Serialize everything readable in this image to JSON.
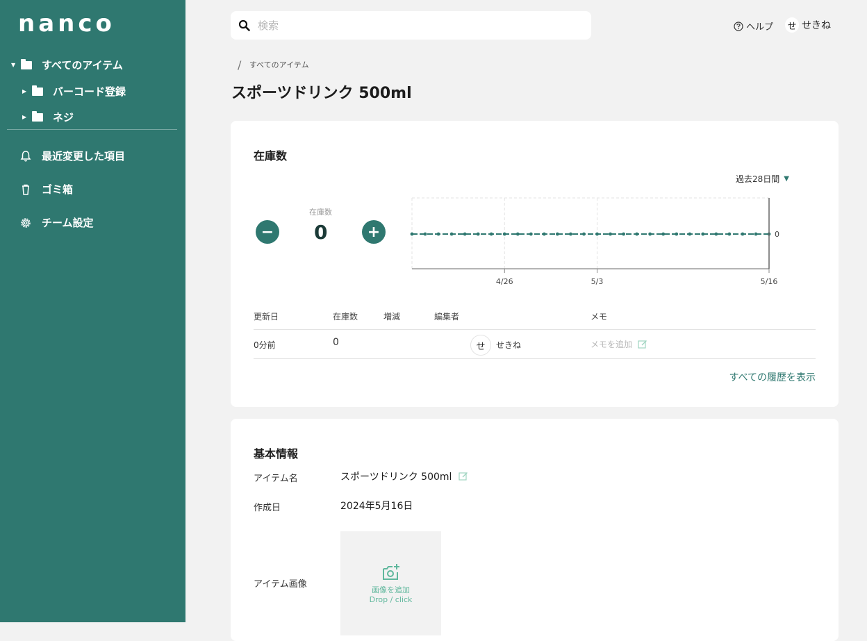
{
  "app": {
    "logo": "nanco"
  },
  "sidebar": {
    "tree": [
      {
        "label": "すべてのアイテム"
      },
      {
        "label": "バーコード登録"
      },
      {
        "label": "ネジ"
      }
    ],
    "nav": [
      {
        "label": "最近変更した項目",
        "icon": "bell-icon"
      },
      {
        "label": "ゴミ箱",
        "icon": "trash-icon"
      },
      {
        "label": "チーム設定",
        "icon": "gear-icon"
      }
    ]
  },
  "header": {
    "search_placeholder": "検索",
    "help_label": "ヘルプ",
    "user_initial": "せ",
    "user_name": "せきね"
  },
  "breadcrumb": {
    "item": "すべてのアイテム"
  },
  "page": {
    "title": "スポーツドリンク 500ml"
  },
  "stock": {
    "title": "在庫数",
    "label": "在庫数",
    "value": "0",
    "minus_label": "−",
    "plus_label": "+",
    "period": "過去28日間"
  },
  "chart_data": {
    "type": "line",
    "x": [
      "4/19",
      "4/20",
      "4/21",
      "4/22",
      "4/23",
      "4/24",
      "4/25",
      "4/26",
      "4/27",
      "4/28",
      "4/29",
      "4/30",
      "5/1",
      "5/2",
      "5/3",
      "5/4",
      "5/5",
      "5/6",
      "5/7",
      "5/8",
      "5/9",
      "5/10",
      "5/11",
      "5/12",
      "5/13",
      "5/14",
      "5/15",
      "5/16"
    ],
    "y": [
      0,
      0,
      0,
      0,
      0,
      0,
      0,
      0,
      0,
      0,
      0,
      0,
      0,
      0,
      0,
      0,
      0,
      0,
      0,
      0,
      0,
      0,
      0,
      0,
      0,
      0,
      0,
      0
    ],
    "xtick_labels": [
      "4/26",
      "5/3",
      "5/16"
    ],
    "ytick_labels": [
      "0"
    ],
    "grid": true,
    "colors": {
      "line": "#2f7870"
    }
  },
  "history": {
    "headers": [
      "更新日",
      "在庫数",
      "増減",
      "編集者",
      "メモ"
    ],
    "rows": [
      {
        "date": "0分前",
        "stock": "0",
        "change": "",
        "editor_initial": "せ",
        "editor": "せきね",
        "memo_placeholder": "メモを追加"
      }
    ],
    "show_all": "すべての履歴を表示"
  },
  "basic_info": {
    "title": "基本情報",
    "name_label": "アイテム名",
    "name_value": "スポーツドリンク 500ml",
    "created_label": "作成日",
    "created_value": "2024年5月16日",
    "image_label": "アイテム画像",
    "image_add": "画像を追加",
    "image_hint": "Drop / click"
  },
  "colors": {
    "primary": "#2f7870",
    "accent": "#5fb79c",
    "background": "#f2f2f2"
  }
}
